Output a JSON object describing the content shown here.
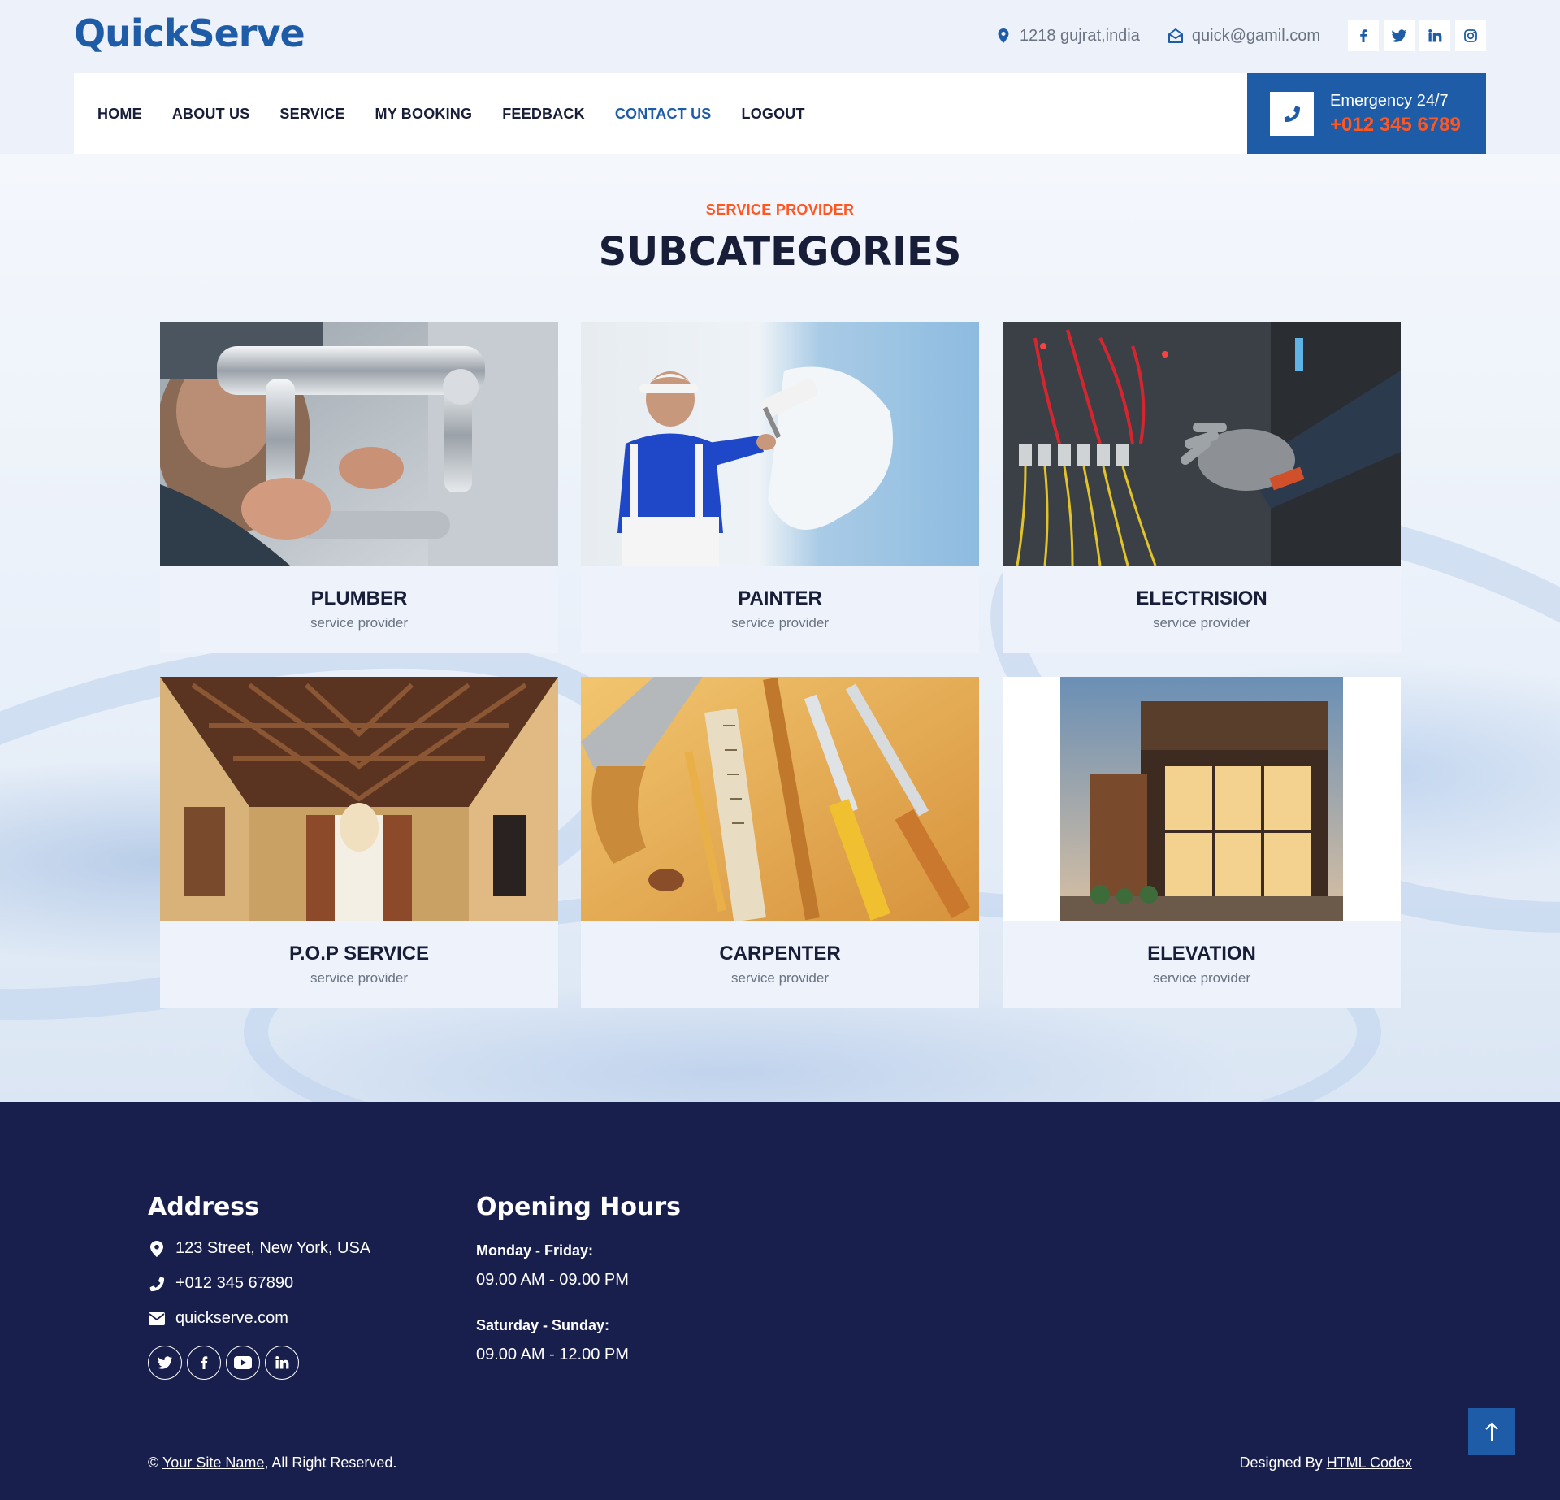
{
  "brand": {
    "name": "QuickServe"
  },
  "topbar": {
    "location": "1218 gujrat,india",
    "email": "quick@gamil.com",
    "socials": [
      "facebook-icon",
      "twitter-icon",
      "linkedin-icon",
      "instagram-icon"
    ]
  },
  "nav": {
    "items": [
      {
        "label": "HOME"
      },
      {
        "label": "ABOUT US"
      },
      {
        "label": "SERVICE"
      },
      {
        "label": "MY BOOKING"
      },
      {
        "label": "FEEDBACK"
      },
      {
        "label": "CONTACT US"
      },
      {
        "label": "LOGOUT"
      }
    ],
    "active": "CONTACT US"
  },
  "emergency": {
    "label": "Emergency 24/7",
    "phone": "+012 345 6789"
  },
  "section": {
    "eyebrow": "SERVICE PROVIDER",
    "title": "SUBCATEGORIES"
  },
  "cards": [
    {
      "title": "PLUMBER",
      "subtitle": "service provider",
      "image": "plumber-photo"
    },
    {
      "title": "PAINTER",
      "subtitle": "service provider",
      "image": "painter-photo"
    },
    {
      "title": "ELECTRISION",
      "subtitle": "service provider",
      "image": "electrician-photo"
    },
    {
      "title": "P.O.P SERVICE",
      "subtitle": "service provider",
      "image": "pop-ceiling-photo"
    },
    {
      "title": "CARPENTER",
      "subtitle": "service provider",
      "image": "carpenter-tools-photo"
    },
    {
      "title": "ELEVATION",
      "subtitle": "service provider",
      "image": "elevation-storefront-photo"
    }
  ],
  "footer": {
    "address": {
      "title": "Address",
      "street": "123 Street, New York, USA",
      "phone": "+012 345 67890",
      "email": "quickserve.com",
      "socials": [
        "twitter-icon",
        "facebook-icon",
        "youtube-icon",
        "linkedin-icon"
      ]
    },
    "hours": {
      "title": "Opening Hours",
      "weekday_label": "Monday - Friday:",
      "weekday_time": "09.00 AM - 09.00 PM",
      "weekend_label": "Saturday - Sunday:",
      "weekend_time": "09.00 AM - 12.00 PM"
    },
    "copyright": {
      "prefix": "©",
      "site_name": "Your Site Name",
      "suffix": ", All Right Reserved."
    },
    "designed": {
      "prefix": "Designed By",
      "link": "HTML Codex"
    }
  },
  "colors": {
    "primary": "#1f5ca8",
    "accent": "#ff5722",
    "dark": "#181d38",
    "footer": "#181f4d"
  }
}
